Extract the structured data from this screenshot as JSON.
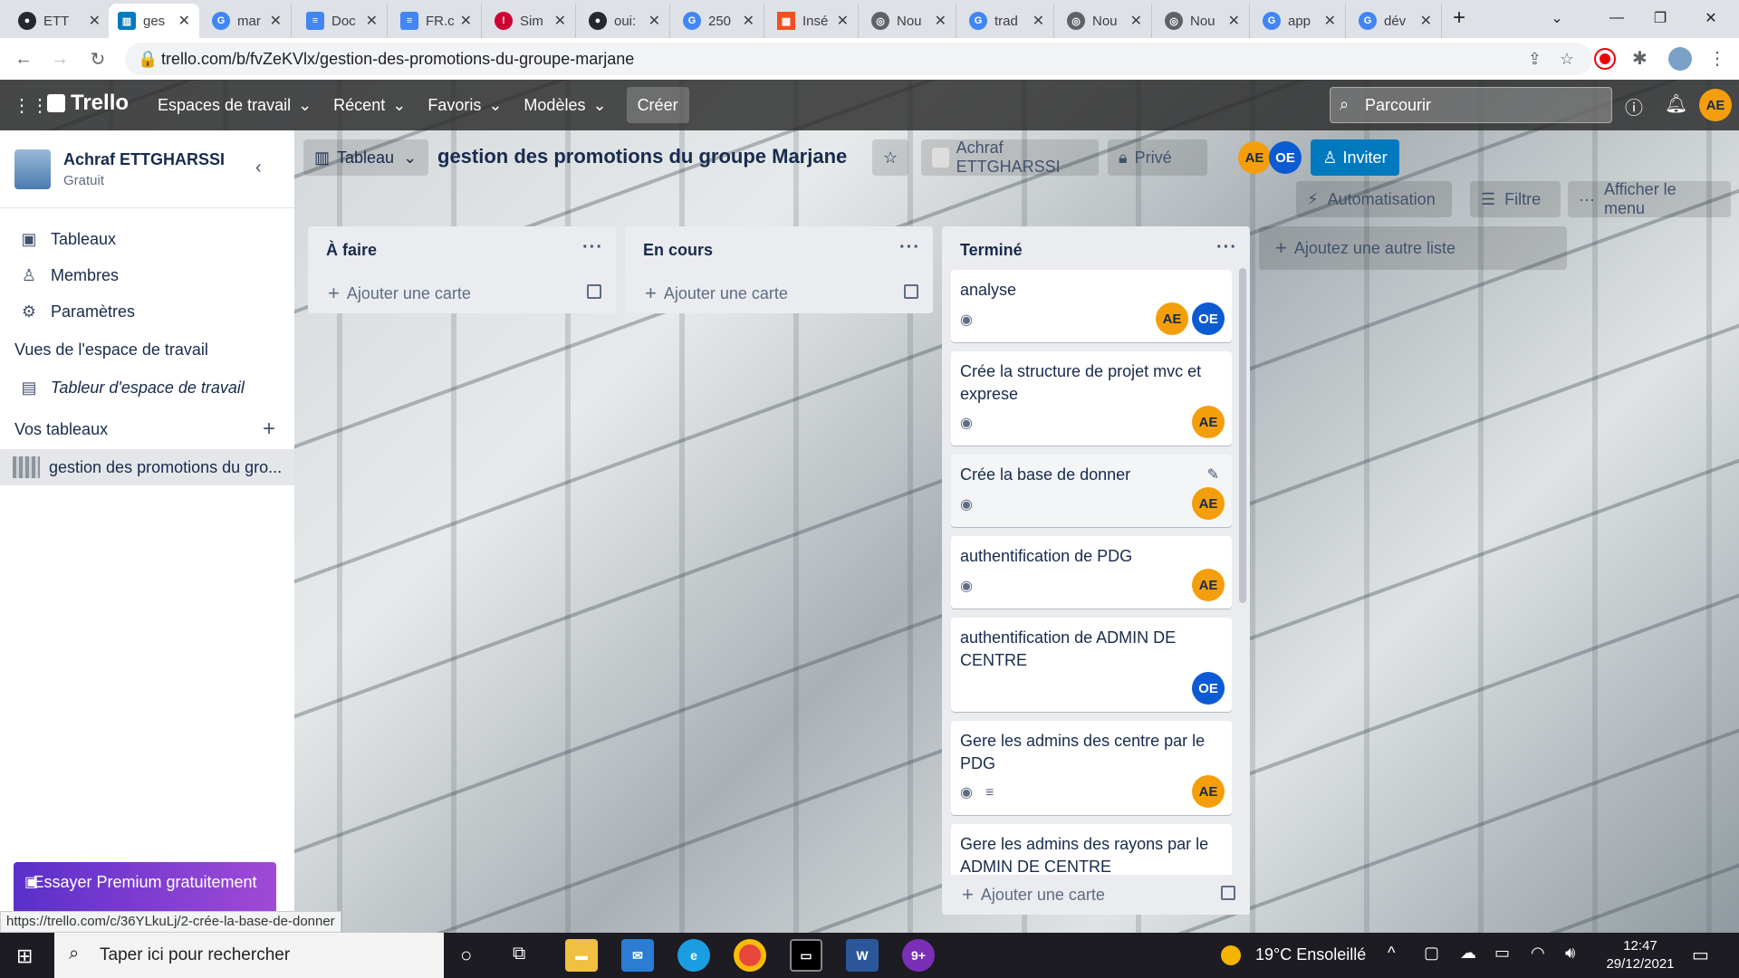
{
  "browser": {
    "tabs": [
      {
        "label": "ETTGHARSSI",
        "icon": "github-icon",
        "color": "#24292f"
      },
      {
        "label": "gestion des promotions",
        "icon": "trello-icon",
        "color": "#0079bf",
        "active": true
      },
      {
        "label": "marjane",
        "icon": "google-icon",
        "color": "#4285f4"
      },
      {
        "label": "Document",
        "icon": "docs-icon",
        "color": "#4285f4"
      },
      {
        "label": "FR.docs",
        "icon": "docs-icon",
        "color": "#4285f4"
      },
      {
        "label": "Simplon",
        "icon": "simplon-icon",
        "color": "#ce0033"
      },
      {
        "label": "ouiSOS",
        "icon": "github-icon",
        "color": "#24292f"
      },
      {
        "label": "250",
        "icon": "google-icon",
        "color": "#4285f4"
      },
      {
        "label": "Insérer",
        "icon": "microsoft-icon",
        "color": "#f25022"
      },
      {
        "label": "Nouvel onglet",
        "icon": "chrome-icon",
        "color": "#5f6368"
      },
      {
        "label": "traduction",
        "icon": "google-icon",
        "color": "#4285f4"
      },
      {
        "label": "Nouvel onglet",
        "icon": "chrome-icon",
        "color": "#5f6368"
      },
      {
        "label": "Nouvel onglet",
        "icon": "chrome-icon",
        "color": "#5f6368"
      },
      {
        "label": "app",
        "icon": "google-icon",
        "color": "#4285f4"
      },
      {
        "label": "développement",
        "icon": "google-icon",
        "color": "#4285f4"
      }
    ],
    "tab_short": [
      "ETT",
      "ges",
      "mar",
      "Doc",
      "FR.c",
      "Sim",
      "oui:",
      "250",
      "Insé",
      "Nou",
      "trad",
      "Nou",
      "Nou",
      "app",
      "dév"
    ],
    "url": "trello.com/b/fvZeKVlx/gestion-des-promotions-du-groupe-marjane",
    "status_url": "https://trello.com/c/36YLkuLj/2-crée-la-base-de-donner"
  },
  "topnav": {
    "logo": "Trello",
    "menus": [
      "Espaces de travail",
      "Récent",
      "Favoris",
      "Modèles"
    ],
    "create": "Créer",
    "search_placeholder": "Parcourir",
    "user_initials": "AE"
  },
  "sidebar": {
    "user_name": "Achraf ETTGHARSSI",
    "plan": "Gratuit",
    "items": [
      {
        "label": "Tableaux",
        "icon": "board-icon"
      },
      {
        "label": "Membres",
        "icon": "person-icon"
      },
      {
        "label": "Paramètres",
        "icon": "gear-icon"
      }
    ],
    "views_title": "Vues de l'espace de travail",
    "workspace_table": "Tableur d'espace de travail",
    "boards_title": "Vos tableaux",
    "board_item": "gestion des promotions du gro...",
    "premium": "Essayer Premium gratuitement"
  },
  "board_header": {
    "view": "Tableau",
    "title": "gestion des promotions du groupe Marjane",
    "workspace": "Achraf ETTGHARSSI",
    "visibility": "Privé",
    "members": [
      "AE",
      "OE"
    ],
    "invite": "Inviter",
    "automation": "Automatisation",
    "filter": "Filtre",
    "menu": "Afficher le menu"
  },
  "lists": [
    {
      "title": "À faire",
      "add": "Ajouter une carte"
    },
    {
      "title": "En cours",
      "add": "Ajouter une carte"
    },
    {
      "title": "Terminé",
      "add": "Ajouter une carte"
    }
  ],
  "add_list": "Ajoutez une autre liste",
  "cards": [
    {
      "title": "analyse",
      "members": [
        "AE",
        "OE"
      ]
    },
    {
      "title": "Crée la structure de projet mvc et exprese",
      "members": [
        "AE"
      ]
    },
    {
      "title": "Crée la base de donner",
      "members": [
        "AE"
      ]
    },
    {
      "title": "authentification de PDG",
      "members": [
        "AE"
      ]
    },
    {
      "title": "authentification de ADMIN DE CENTRE",
      "members": [
        "OE"
      ]
    },
    {
      "title": "Gere les admins des centre par le PDG",
      "members": [
        "AE"
      ]
    },
    {
      "title": "Gere les admins des rayons par le ADMIN DE CENTRE",
      "members": []
    }
  ],
  "taskbar": {
    "search": "Taper ici pour rechercher",
    "weather": "19°C  Ensoleillé",
    "time": "12:47",
    "date": "29/12/2021"
  }
}
